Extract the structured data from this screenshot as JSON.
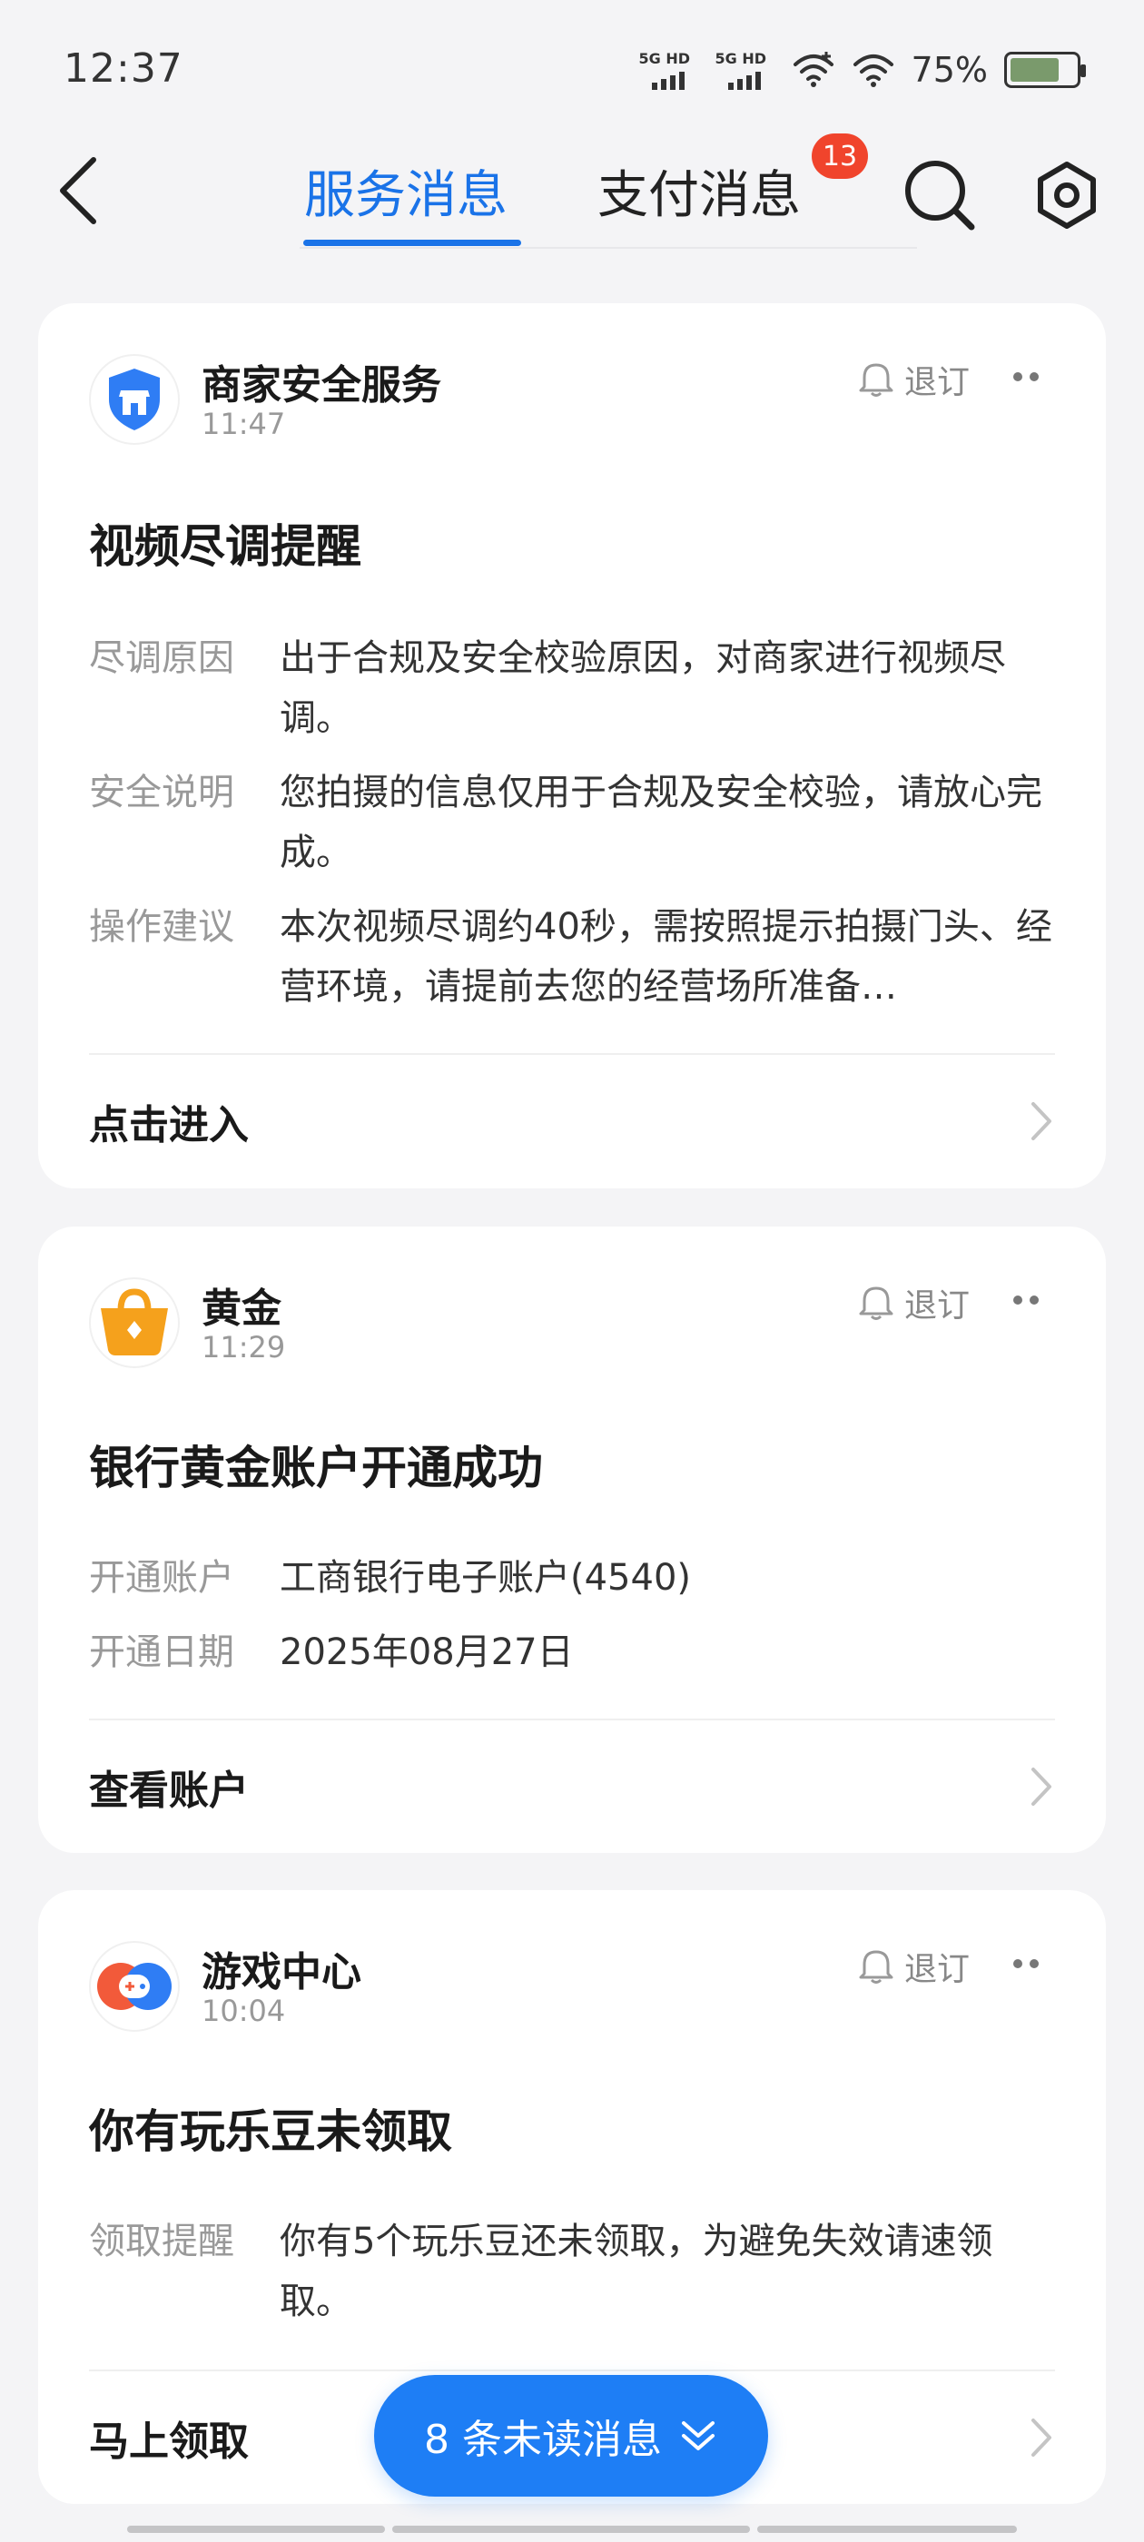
{
  "status_bar": {
    "time": "12:37",
    "sim1": "5G HD",
    "sim2": "5G HD",
    "battery": "75%",
    "battery_level": 0.75
  },
  "header": {
    "back_icon": "chevron-left-icon",
    "tabs": [
      {
        "label": "服务消息",
        "active": true
      },
      {
        "label": "支付消息",
        "active": false,
        "badge": "13"
      }
    ],
    "search_icon": "search-icon",
    "settings_icon": "gear-icon"
  },
  "colors": {
    "accent": "#1a73e8",
    "badge": "#f0442c",
    "pill": "#1e7ef5",
    "page_bg": "#f4f4f6"
  },
  "cards": [
    {
      "sender": "商家安全服务",
      "time": "11:47",
      "icon": "shield-store-icon",
      "unsubscribe": "退订",
      "title": "视频尽调提醒",
      "fields": [
        {
          "key": "尽调原因",
          "value": "出于合规及安全校验原因，对商家进行视频尽调。"
        },
        {
          "key": "安全说明",
          "value": "您拍摄的信息仅用于合规及安全校验，请放心完成。"
        },
        {
          "key": "操作建议",
          "value": "本次视频尽调约40秒，需按照提示拍摄门头、经营环境，请提前去您的经营场所准备…"
        }
      ],
      "action": "点击进入"
    },
    {
      "sender": "黄金",
      "time": "11:29",
      "icon": "gold-bag-icon",
      "unsubscribe": "退订",
      "title": "银行黄金账户开通成功",
      "fields": [
        {
          "key": "开通账户",
          "value": "工商银行电子账户(4540)"
        },
        {
          "key": "开通日期",
          "value": "2025年08月27日"
        }
      ],
      "action": "查看账户"
    },
    {
      "sender": "游戏中心",
      "time": "10:04",
      "icon": "gamepad-icon",
      "unsubscribe": "退订",
      "title": "你有玩乐豆未领取",
      "fields": [
        {
          "key": "领取提醒",
          "value": "你有5个玩乐豆还未领取，为避免失效请速领取。"
        }
      ],
      "action": "马上领取"
    }
  ],
  "unread_pill": {
    "label": "8 条未读消息",
    "icon": "double-chevron-down-icon"
  }
}
